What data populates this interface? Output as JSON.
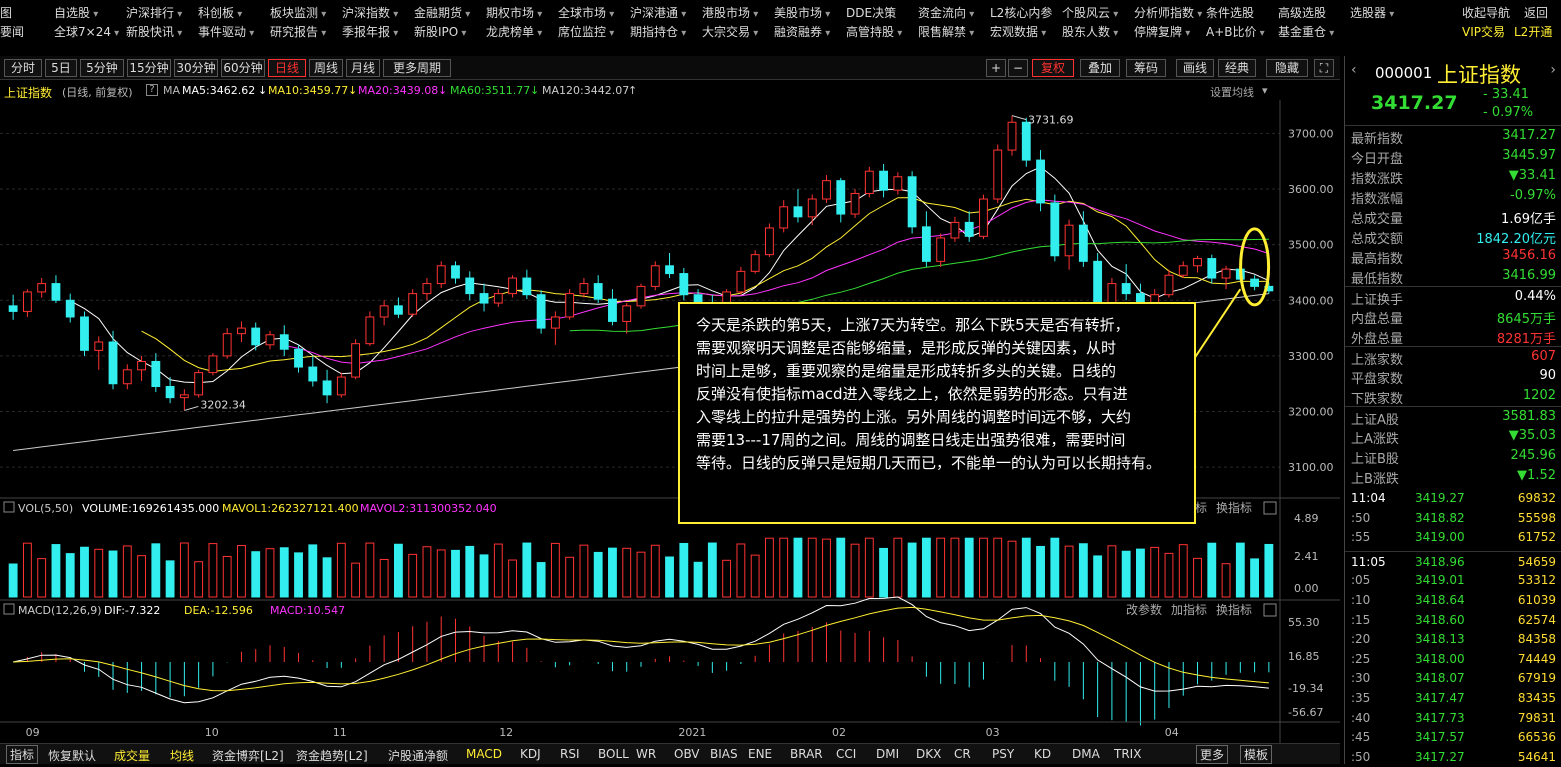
{
  "menu_row1": [
    "自选股",
    "沪深排行",
    "科创板",
    "板块监测",
    "沪深指数",
    "金融期货",
    "期权市场",
    "全球市场",
    "沪深港通",
    "港股市场",
    "美股市场",
    "DDE决策",
    "资金流向",
    "L2核心内参",
    "个股风云",
    "分析师指数",
    "条件选股",
    "高级选股",
    "选股器",
    "收起导航",
    "返回"
  ],
  "menu_row2": [
    "全球7×24",
    "新股快讯",
    "事件驱动",
    "研究报告",
    "季报年报",
    "新股IPO",
    "龙虎榜单",
    "席位监控",
    "期指持仓",
    "大宗交易",
    "融资融券",
    "高管持股",
    "限售解禁",
    "宏观数据",
    "股东人数",
    "停牌复牌",
    "A+B比价",
    "基金重仓",
    "VIP交易",
    "L2开通"
  ],
  "left_stub": [
    "要闻",
    "图"
  ],
  "period_tabs": [
    "分时",
    "5日",
    "5分钟",
    "15分钟",
    "30分钟",
    "60分钟",
    "日线",
    "周线",
    "月线",
    "更多周期"
  ],
  "active_period": "日线",
  "toolbar_right": [
    "+",
    "−",
    "复权",
    "叠加",
    "筹码",
    "画线",
    "经典",
    "隐藏"
  ],
  "legend": {
    "name": "上证指数",
    "mode": "(日线, 前复权)",
    "ma_label": "MA",
    "ma5": "MA5:3462.62",
    "ma10": "MA10:3459.77",
    "ma20": "MA20:3439.08",
    "ma60": "MA60:3511.77",
    "ma120": "MA120:3442.07",
    "settings": "设置均线"
  },
  "price_axis": [
    "3700.00",
    "3600.00",
    "3500.00",
    "3400.00",
    "3300.00",
    "3200.00",
    "3100.00"
  ],
  "high_label": "3731.69",
  "low_label": "3202.34",
  "vol_legend": {
    "title": "VOL(5,50)",
    "volume": "VOLUME:169261435.000",
    "mavol1": "MAVOL1:262327121.400",
    "mavol2": "MAVOL2:311300352.040"
  },
  "vol_axis": [
    "4.89",
    "2.41",
    "0.00"
  ],
  "macd_legend": {
    "title": "MACD(12,26,9)",
    "dif": "DIF:-7.322",
    "dea": "DEA:-12.596",
    "macd": "MACD:10.547"
  },
  "macd_axis": [
    "55.30",
    "16.85",
    "-19.34",
    "-56.67"
  ],
  "panel_tools": [
    "改参数",
    "加指标",
    "换指标"
  ],
  "time_axis": [
    "09",
    "10",
    "11",
    "12",
    "2021",
    "02",
    "03",
    "04"
  ],
  "annotation": [
    "今天是杀跌的第5天，上涨7天为转空。那么下跌5天是否有转折，",
    "需要观察明天调整是否能够缩量，是形成反弹的关键因素，从时",
    "时间上是够，重要观察的是缩量是形成转折多头的关键。日线的",
    "反弹没有使指标macd进入零线之上，依然是弱势的形态。只有进",
    "入零线上的拉升是强势的上涨。另外周线的调整时间远不够，大约",
    "需要13---17周的之间。周线的调整日线走出强势很难，需要时间",
    "等待。日线的反弹只是短期几天而已，不能单一的认为可以长期持有。"
  ],
  "quote": {
    "code": "000001",
    "name": "上证指数",
    "price": "3417.27",
    "change": "- 33.41",
    "pct": "- 0.97%",
    "rows": [
      {
        "l": "最新指数",
        "v": "3417.27",
        "c": "green"
      },
      {
        "l": "今日开盘",
        "v": "3445.97",
        "c": "green"
      },
      {
        "l": "指数涨跌",
        "v": "▼33.41",
        "c": "green"
      },
      {
        "l": "指数涨幅",
        "v": "-0.97%",
        "c": "green"
      },
      {
        "l": "总成交量",
        "v": "1.69亿手",
        "c": "white"
      },
      {
        "l": "总成交额",
        "v": "1842.20亿元",
        "c": "cyan"
      },
      {
        "l": "最高指数",
        "v": "3456.16",
        "c": "red"
      },
      {
        "l": "最低指数",
        "v": "3416.99",
        "c": "green"
      },
      {
        "l": "上证换手",
        "v": "0.44%",
        "c": "white"
      },
      {
        "l": "内盘总量",
        "v": "8645万手",
        "c": "green"
      },
      {
        "l": "外盘总量",
        "v": "8281万手",
        "c": "red"
      },
      {
        "l": "上涨家数",
        "v": "607",
        "c": "red"
      },
      {
        "l": "平盘家数",
        "v": "90",
        "c": "white"
      },
      {
        "l": "下跌家数",
        "v": "1202",
        "c": "green"
      },
      {
        "l": "上证A股",
        "v": "3581.83",
        "c": "green"
      },
      {
        "l": "上A涨跌",
        "v": "▼35.03",
        "c": "green"
      },
      {
        "l": "上证B股",
        "v": "245.96",
        "c": "green"
      },
      {
        "l": "上B涨跌",
        "v": "▼1.52",
        "c": "green"
      }
    ],
    "ticks": [
      {
        "t": "11:04",
        "p": "3419.27",
        "q": "69832"
      },
      {
        "t": ":50",
        "p": "3418.82",
        "q": "55598"
      },
      {
        "t": ":55",
        "p": "3419.00",
        "q": "61752"
      },
      {
        "t": "11:05",
        "p": "3418.96",
        "q": "54659"
      },
      {
        "t": ":05",
        "p": "3419.01",
        "q": "53312"
      },
      {
        "t": ":10",
        "p": "3418.64",
        "q": "61039"
      },
      {
        "t": ":15",
        "p": "3418.60",
        "q": "62574"
      },
      {
        "t": ":20",
        "p": "3418.13",
        "q": "84358"
      },
      {
        "t": ":25",
        "p": "3418.00",
        "q": "74449"
      },
      {
        "t": ":30",
        "p": "3418.07",
        "q": "67919"
      },
      {
        "t": ":35",
        "p": "3417.47",
        "q": "83435"
      },
      {
        "t": ":40",
        "p": "3417.73",
        "q": "79831"
      },
      {
        "t": ":45",
        "p": "3417.57",
        "q": "66536"
      },
      {
        "t": ":50",
        "p": "3417.27",
        "q": "54641"
      }
    ]
  },
  "bottom_tabs": [
    "指标",
    "恢复默认",
    "成交量",
    "均线",
    "资金博弈[L2]",
    "资金趋势[L2]",
    "沪股通净额",
    "MACD",
    "KDJ",
    "RSI",
    "BOLL",
    "WR",
    "OBV",
    "BIAS",
    "ENE",
    "BRAR",
    "CCI",
    "DMI",
    "DKX",
    "CR",
    "PSY",
    "KD",
    "DMA",
    "TRIX",
    "更多",
    "模板"
  ],
  "colors": {
    "up": "#ff3333",
    "down": "#33eeee",
    "ma5": "#ffffff",
    "ma10": "#ffee33",
    "ma20": "#ff33ff",
    "ma60": "#33dd33",
    "ma120": "#cccccc",
    "accent": "#ffee33"
  },
  "chart_data": {
    "type": "candlestick",
    "title": "上证指数",
    "ylim": [
      3050,
      3760
    ],
    "series": [
      {
        "name": "OHLC",
        "values": [
          [
            3390,
            3410,
            3365,
            3380
          ],
          [
            3380,
            3420,
            3370,
            3415
          ],
          [
            3415,
            3440,
            3405,
            3430
          ],
          [
            3430,
            3445,
            3395,
            3400
          ],
          [
            3400,
            3412,
            3360,
            3370
          ],
          [
            3370,
            3380,
            3300,
            3310
          ],
          [
            3310,
            3335,
            3275,
            3325
          ],
          [
            3325,
            3345,
            3240,
            3250
          ],
          [
            3250,
            3285,
            3240,
            3275
          ],
          [
            3275,
            3300,
            3255,
            3290
          ],
          [
            3290,
            3305,
            3235,
            3245
          ],
          [
            3245,
            3262,
            3215,
            3225
          ],
          [
            3225,
            3240,
            3202,
            3230
          ],
          [
            3230,
            3275,
            3225,
            3270
          ],
          [
            3270,
            3305,
            3265,
            3300
          ],
          [
            3300,
            3350,
            3295,
            3340
          ],
          [
            3340,
            3362,
            3325,
            3350
          ],
          [
            3350,
            3360,
            3310,
            3320
          ],
          [
            3320,
            3345,
            3312,
            3338
          ],
          [
            3338,
            3355,
            3300,
            3312
          ],
          [
            3312,
            3320,
            3270,
            3280
          ],
          [
            3280,
            3300,
            3245,
            3255
          ],
          [
            3255,
            3275,
            3215,
            3230
          ],
          [
            3230,
            3270,
            3225,
            3262
          ],
          [
            3262,
            3330,
            3258,
            3322
          ],
          [
            3322,
            3380,
            3318,
            3370
          ],
          [
            3370,
            3400,
            3355,
            3390
          ],
          [
            3390,
            3405,
            3368,
            3375
          ],
          [
            3375,
            3420,
            3370,
            3412
          ],
          [
            3412,
            3440,
            3400,
            3430
          ],
          [
            3430,
            3470,
            3422,
            3462
          ],
          [
            3462,
            3470,
            3430,
            3440
          ],
          [
            3440,
            3452,
            3400,
            3412
          ],
          [
            3412,
            3430,
            3380,
            3395
          ],
          [
            3395,
            3420,
            3388,
            3412
          ],
          [
            3412,
            3445,
            3405,
            3440
          ],
          [
            3440,
            3455,
            3402,
            3410
          ],
          [
            3410,
            3418,
            3340,
            3350
          ],
          [
            3350,
            3380,
            3320,
            3370
          ],
          [
            3370,
            3420,
            3365,
            3412
          ],
          [
            3412,
            3440,
            3405,
            3430
          ],
          [
            3430,
            3445,
            3395,
            3402
          ],
          [
            3402,
            3420,
            3355,
            3362
          ],
          [
            3362,
            3395,
            3340,
            3390
          ],
          [
            3390,
            3430,
            3385,
            3425
          ],
          [
            3425,
            3470,
            3418,
            3462
          ],
          [
            3462,
            3485,
            3440,
            3448
          ],
          [
            3448,
            3458,
            3400,
            3410
          ],
          [
            3410,
            3420,
            3380,
            3395
          ],
          [
            3395,
            3410,
            3360,
            3370
          ],
          [
            3370,
            3420,
            3365,
            3415
          ],
          [
            3415,
            3460,
            3410,
            3452
          ],
          [
            3452,
            3490,
            3448,
            3482
          ],
          [
            3482,
            3538,
            3478,
            3530
          ],
          [
            3530,
            3580,
            3522,
            3568
          ],
          [
            3568,
            3600,
            3540,
            3550
          ],
          [
            3550,
            3590,
            3535,
            3582
          ],
          [
            3582,
            3625,
            3575,
            3615
          ],
          [
            3615,
            3620,
            3540,
            3555
          ],
          [
            3555,
            3600,
            3548,
            3592
          ],
          [
            3592,
            3640,
            3585,
            3632
          ],
          [
            3632,
            3645,
            3585,
            3598
          ],
          [
            3598,
            3630,
            3590,
            3622
          ],
          [
            3622,
            3632,
            3520,
            3532
          ],
          [
            3532,
            3560,
            3460,
            3470
          ],
          [
            3470,
            3520,
            3460,
            3512
          ],
          [
            3512,
            3550,
            3505,
            3540
          ],
          [
            3540,
            3560,
            3505,
            3515
          ],
          [
            3515,
            3590,
            3510,
            3582
          ],
          [
            3582,
            3680,
            3575,
            3670
          ],
          [
            3670,
            3732,
            3660,
            3720
          ],
          [
            3720,
            3728,
            3640,
            3652
          ],
          [
            3652,
            3670,
            3560,
            3575
          ],
          [
            3575,
            3590,
            3470,
            3480
          ],
          [
            3480,
            3545,
            3455,
            3535
          ],
          [
            3535,
            3560,
            3460,
            3470
          ],
          [
            3470,
            3485,
            3380,
            3390
          ],
          [
            3390,
            3440,
            3355,
            3430
          ],
          [
            3430,
            3465,
            3400,
            3412
          ],
          [
            3412,
            3430,
            3365,
            3375
          ],
          [
            3375,
            3420,
            3360,
            3410
          ],
          [
            3410,
            3455,
            3405,
            3445
          ],
          [
            3445,
            3470,
            3440,
            3462
          ],
          [
            3462,
            3480,
            3450,
            3475
          ],
          [
            3475,
            3482,
            3430,
            3440
          ],
          [
            3440,
            3462,
            3420,
            3456
          ],
          [
            3456,
            3462,
            3432,
            3438
          ],
          [
            3438,
            3445,
            3418,
            3425
          ],
          [
            3425,
            3432,
            3412,
            3417
          ]
        ]
      }
    ]
  }
}
